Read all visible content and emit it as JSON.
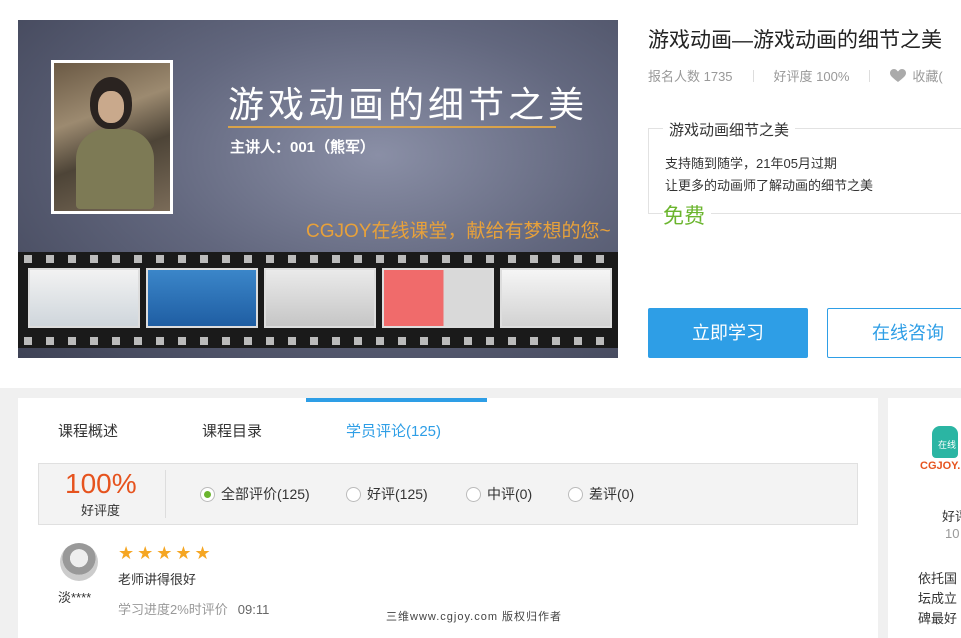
{
  "banner": {
    "title": "游戏动画的细节之美",
    "subtitle": "主讲人：001（熊军）",
    "slogan": "CGJOY在线课堂，献给有梦想的您~"
  },
  "course": {
    "title": "游戏动画—游戏动画的细节之美",
    "enrolled": "报名人数 1735",
    "rating": "好评度 100%",
    "favorite": "收藏(",
    "box_title": "游戏动画细节之美",
    "box_line1": "支持随到随学，21年05月过期",
    "box_line2": "让更多的动画师了解动画的细节之美",
    "price": "免费"
  },
  "actions": {
    "study": "立即学习",
    "consult": "在线咨询"
  },
  "tabs": [
    {
      "label": "课程概述"
    },
    {
      "label": "课程目录"
    },
    {
      "label": "学员评论(125)"
    }
  ],
  "reviews": {
    "percent": "100%",
    "percent_label": "好评度",
    "filters": [
      {
        "label": "全部评价(125)",
        "selected": true
      },
      {
        "label": "好评(125)",
        "selected": false
      },
      {
        "label": "中评(0)",
        "selected": false
      },
      {
        "label": "差评(0)",
        "selected": false
      }
    ],
    "items": [
      {
        "user": "淡****",
        "stars": "★★★★★",
        "rating": 5,
        "text": "老师讲得很好",
        "progress": "学习进度2%时评价",
        "time": "09:11"
      }
    ]
  },
  "sidebar": {
    "logo": "CGJOY.",
    "logo_sub": "在线",
    "line1": "好评",
    "line2": "10",
    "line3": "依托国",
    "line4": "坛成立",
    "line5": "碑最好"
  },
  "watermark": "三维www.cgjoy.com 版权归作者",
  "colors": {
    "accent": "#2e9ee6",
    "price": "#6bb52e",
    "highlight": "#e6531e",
    "star": "#f5a623"
  }
}
